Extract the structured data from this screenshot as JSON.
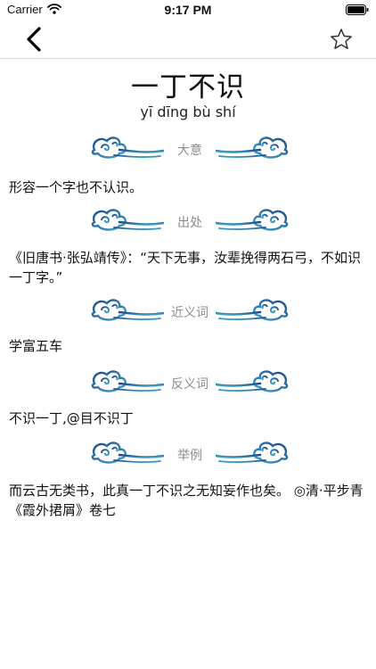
{
  "status_bar": {
    "carrier": "Carrier",
    "time": "9:17 PM"
  },
  "entry": {
    "title": "一丁不识",
    "pinyin": "yī dīng bù shí"
  },
  "sections": {
    "meaning": {
      "label": "大意",
      "text": "形容一个字也不认识。"
    },
    "source": {
      "label": "出处",
      "text": "《旧唐书·张弘靖传》：“天下无事，汝辈挽得两石弓，不如识一丁字。”"
    },
    "synonyms": {
      "label": "近义词",
      "text": "学富五车"
    },
    "antonyms": {
      "label": "反义词",
      "text": "不识一丁,@目不识丁"
    },
    "example": {
      "label": "举例",
      "text": "而云古无类书，此真一丁不识之无知妄作也矣。 ◎清·平步青《霞外捃屑》卷七"
    }
  },
  "colors": {
    "cloud_dark": "#1f4a8a",
    "cloud_light": "#3fa9c9",
    "label_gray": "#8c8c8c"
  },
  "icons": {
    "back": "chevron-left-icon",
    "favorite": "star-outline-icon",
    "wifi": "wifi-icon",
    "battery": "battery-icon"
  }
}
